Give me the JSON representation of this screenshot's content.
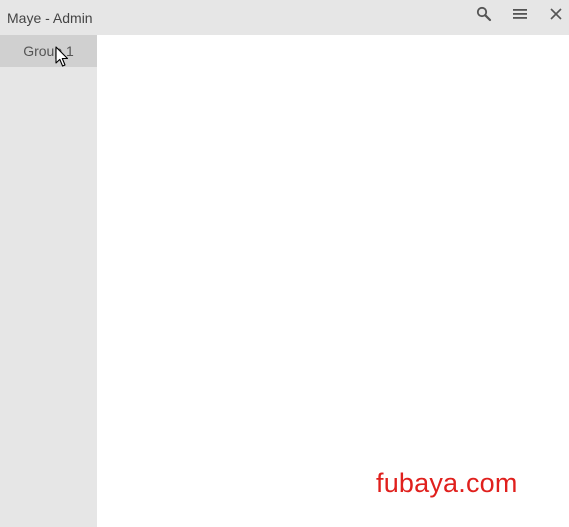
{
  "window": {
    "title": "Maye - Admin"
  },
  "titlebar": {
    "buttons": [
      {
        "icon": "search-icon"
      },
      {
        "icon": "menu-icon"
      },
      {
        "icon": "close-icon"
      }
    ]
  },
  "sidebar": {
    "items": [
      {
        "label": "Group 1",
        "selected": true
      }
    ]
  },
  "watermark": {
    "text": "fubaya.com",
    "color": "#e0201d"
  },
  "colors": {
    "titlebar_bg": "#e6e6e6",
    "sidebar_bg": "#e6e6e6",
    "selected_item_bg": "#d0d0d0",
    "content_bg": "#ffffff"
  }
}
